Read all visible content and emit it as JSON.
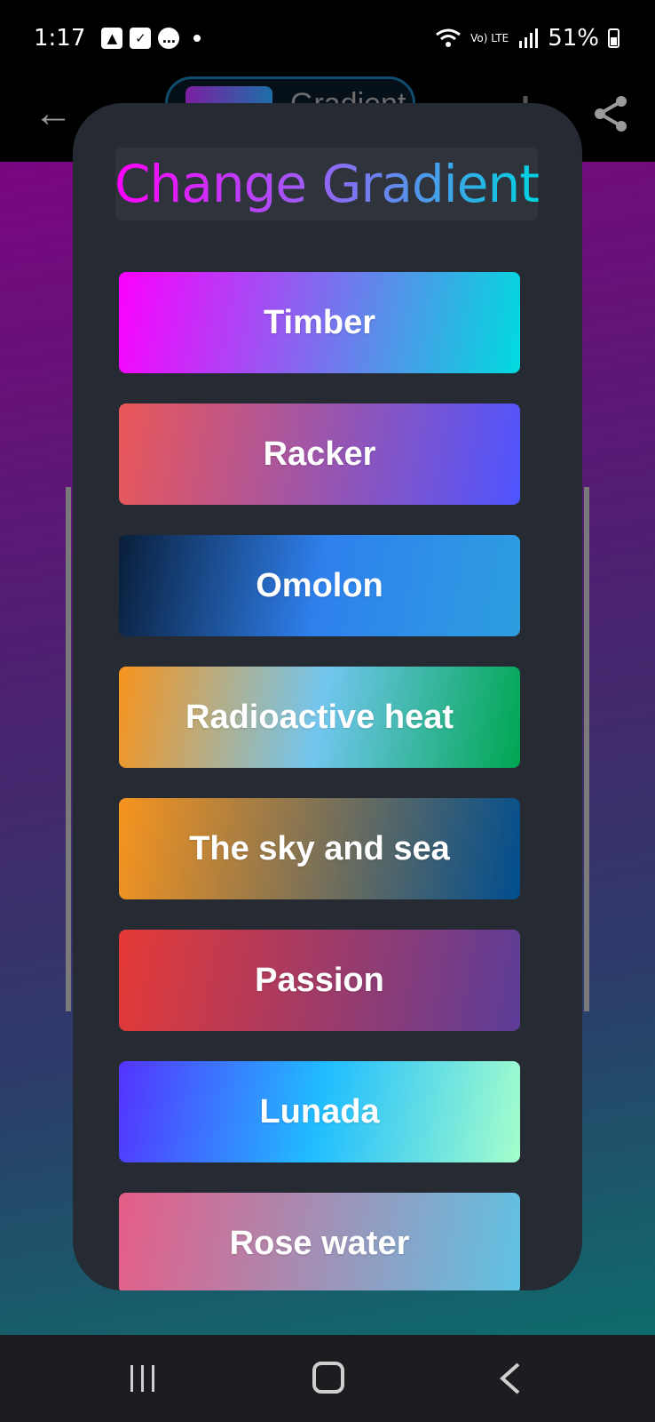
{
  "status_bar": {
    "time": "1:17",
    "battery": "51%",
    "network": "Vo) LTE"
  },
  "app_bar": {
    "chip_label": "Gradient",
    "back_icon": "arrow-left-icon",
    "download_icon": "download-icon",
    "share_icon": "share-icon"
  },
  "dialog": {
    "title": "Change Gradient",
    "gradients": [
      {
        "label": "Timber",
        "colors": [
          "#fc00ff",
          "#00dbde"
        ]
      },
      {
        "label": "Racker",
        "colors": [
          "#eb5757",
          "#4e54ff"
        ]
      },
      {
        "label": "Omolon",
        "colors": [
          "#091e3a",
          "#2f80ed",
          "#2d9ee0"
        ]
      },
      {
        "label": "Radioactive heat",
        "colors": [
          "#f7941e",
          "#72c6ef",
          "#00a651"
        ]
      },
      {
        "label": "The sky and sea",
        "colors": [
          "#f7941e",
          "#004e8f"
        ]
      },
      {
        "label": "Passion",
        "colors": [
          "#e53935",
          "#5c3d99"
        ]
      },
      {
        "label": "Lunada",
        "colors": [
          "#5433ff",
          "#20bdff",
          "#a5fecb"
        ]
      },
      {
        "label": "Rose water",
        "colors": [
          "#e55d87",
          "#5fc3e4"
        ]
      }
    ]
  },
  "nav_bar": {
    "recents_icon": "recents-icon",
    "home_icon": "home-icon",
    "back_icon": "back-icon"
  }
}
